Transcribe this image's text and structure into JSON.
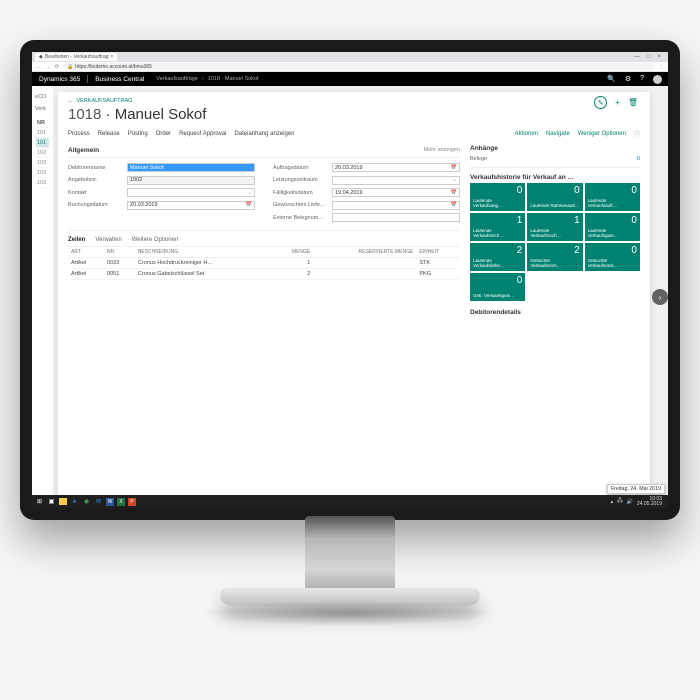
{
  "browser": {
    "tab_title": "Bearbeiten - Verkaufsauftrag",
    "url": "https://bcdemo.account.at/bmu365"
  },
  "header": {
    "app": "Dynamics 365",
    "product": "Business Central",
    "crumb1": "Verkaufsaufträge",
    "crumb2": "1018 · Manuel Sokof"
  },
  "bgpanel": {
    "title": "eCO",
    "subtitle": "Verk",
    "col": "NR",
    "rows": [
      "101",
      "101",
      "102",
      "102",
      "102",
      "102"
    ],
    "activeIndex": 1
  },
  "card": {
    "breadcrumb_back": "←",
    "breadcrumb": "VERKAUFSAUFTRAG",
    "title_nr": "1018",
    "title_sep": " · ",
    "title_name": "Manuel Sokof",
    "actions": {
      "process": "Process",
      "release": "Release",
      "posting": "Posting",
      "order": "Order",
      "request": "Request Approval",
      "attach": "Dateianhang anzeigen",
      "aktionen": "Aktionen",
      "navigate": "Navigate",
      "less": "Weniger Optionen"
    }
  },
  "general": {
    "heading": "Allgemein",
    "more": "Mehr anzeigen",
    "fields_left": [
      {
        "label": "Debitorenname",
        "value": "Manuel Sokof",
        "selected": true,
        "dd": true
      },
      {
        "label": "Angebotsnr.",
        "value": "1002",
        "ro": true
      },
      {
        "label": "Kontakt",
        "value": "",
        "dd": true
      },
      {
        "label": "Buchungsdatum",
        "value": "20.03.2019",
        "cal": true
      }
    ],
    "fields_right": [
      {
        "label": "Auftragsdatum",
        "value": "20.03.2019",
        "cal": true
      },
      {
        "label": "Leistungszeitraum",
        "value": "",
        "dd": true
      },
      {
        "label": "Fälligkeitsdatum",
        "value": "19.04.2019",
        "cal": true
      },
      {
        "label": "Gewünschtes Liefe…",
        "value": "",
        "cal": true
      },
      {
        "label": "Externe Belegnum…",
        "value": ""
      }
    ]
  },
  "lines": {
    "tabs": {
      "zeilen": "Zeilen",
      "verwalten": "Verwalten",
      "weitere": "Weitere Optionen"
    },
    "headers": {
      "art": "ART",
      "nr": "NR.",
      "beschreibung": "BESCHREIBUNG",
      "menge": "MENGE",
      "reserviert": "RESERVIERTE MENGE",
      "einheit": "EINHEIT"
    },
    "rows": [
      {
        "art": "Artikel",
        "nr": "0033",
        "beschr": "Cronus Hochdruckreiniger H…",
        "menge": "1",
        "res": "",
        "einheit": "STK"
      },
      {
        "art": "Artikel",
        "nr": "0051",
        "beschr": "Cronus Gabelschlüssel Set",
        "menge": "2",
        "res": "",
        "einheit": "PKG"
      }
    ]
  },
  "side": {
    "anhaenge": "Anhänge",
    "belege": "Belege",
    "belege_n": "0",
    "history": "Verkaufshistorie für Verkauf an …",
    "tiles": [
      {
        "n": "0",
        "l": "Laufende Verkaufsang…"
      },
      {
        "n": "0",
        "l": "Laufende Rahmenauft…"
      },
      {
        "n": "0",
        "l": "Laufende Verkaufsauft…"
      },
      {
        "n": "1",
        "l": "Laufende Verkaufsrech…"
      },
      {
        "n": "1",
        "l": "Laufende Verkaufsrech…"
      },
      {
        "n": "0",
        "l": "Laufende Verkaufsguts…"
      },
      {
        "n": "2",
        "l": "Laufende Verkaufsliefer…"
      },
      {
        "n": "2",
        "l": "Gebuchte Verkaufsrech…"
      },
      {
        "n": "0",
        "l": "Gebuchte Verkaufsrück…"
      },
      {
        "n": "0",
        "l": "Geb. Verkaufsguts…"
      }
    ],
    "details_h": "Debitorendetails"
  },
  "taskbar": {
    "date_tooltip": "Freitag, 24. Mai 2019",
    "time": "10:03",
    "date": "24.05.2019"
  }
}
